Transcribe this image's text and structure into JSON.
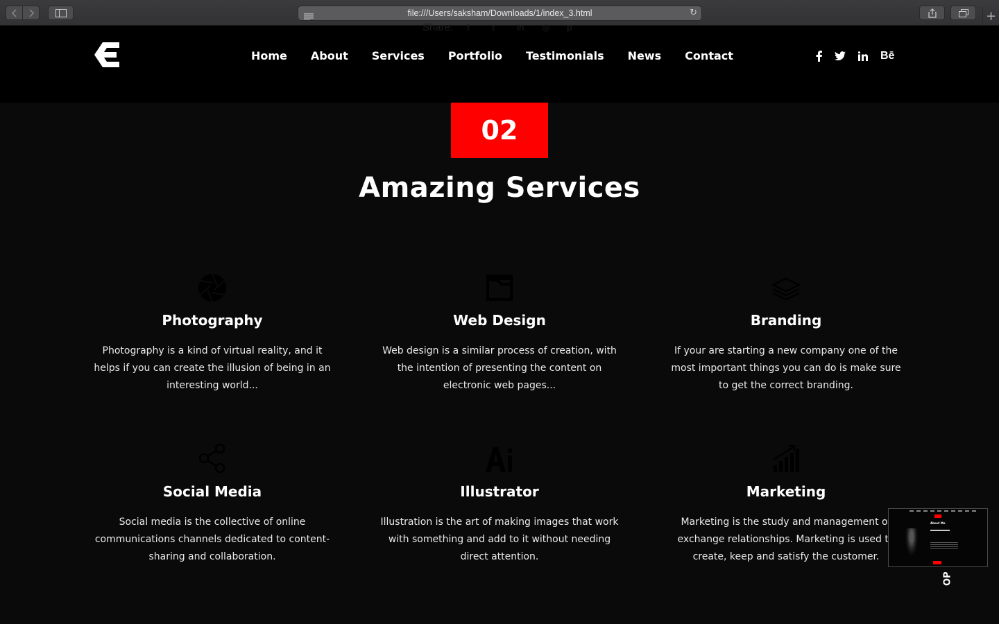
{
  "browser": {
    "url": "file:///Users/saksham/Downloads/1/index_3.html"
  },
  "header": {
    "faint_share_label": "Share:",
    "nav": [
      "Home",
      "About",
      "Services",
      "Portfolio",
      "Testimonials",
      "News",
      "Contact"
    ],
    "socials": [
      "facebook-icon",
      "twitter-icon",
      "linkedin-icon",
      "behance-icon"
    ],
    "behance_label": "Bē"
  },
  "section": {
    "number": "02",
    "title": "Amazing Services",
    "accent_color": "#ff0000"
  },
  "services": [
    {
      "icon": "camera-aperture-icon",
      "title": "Photography",
      "text": "Photography is a kind of virtual reality, and it helps if you can create the illusion of being in an interesting world..."
    },
    {
      "icon": "browser-window-icon",
      "title": "Web Design",
      "text": "Web design is a similar process of creation, with the intention of presenting the content on electronic web pages..."
    },
    {
      "icon": "layers-icon",
      "title": "Branding",
      "text": "If your are starting a new company one of the most important things you can do is make sure to get the correct branding."
    },
    {
      "icon": "share-icon",
      "title": "Social Media",
      "text": "Social media is the collective of online communications channels dedicated to content-sharing and collaboration."
    },
    {
      "icon": "illustrator-icon",
      "title": "Illustrator",
      "text": "Illustration is the art of making images that work with something and add to it without needing direct attention."
    },
    {
      "icon": "growth-chart-icon",
      "title": "Marketing",
      "text": "Marketing is the study and management of exchange relationships. Marketing is used to create, keep and satisfy the customer."
    }
  ],
  "back_to_top": {
    "label": "OP"
  },
  "preview": {
    "title": "About Me"
  }
}
